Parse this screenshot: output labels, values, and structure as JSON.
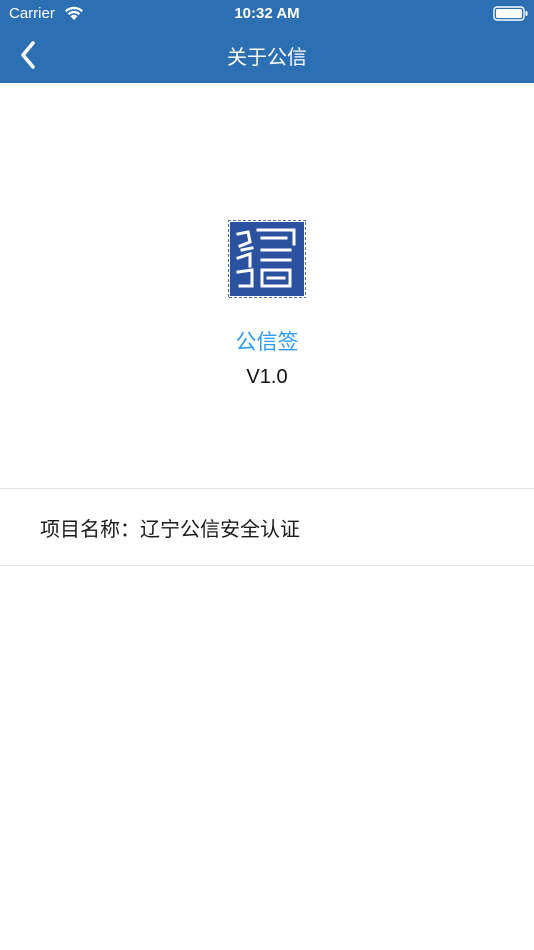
{
  "status_bar": {
    "carrier": "Carrier",
    "time": "10:32 AM"
  },
  "nav": {
    "title": "关于公信",
    "back_icon": "chevron-left-icon",
    "color": "#2c6fb2"
  },
  "app": {
    "logo_icon": "gongxin-seal-logo",
    "name": "公信签",
    "version": "V1.0",
    "name_color": "#2b9af3"
  },
  "project": {
    "label": "项目名称：",
    "value": "辽宁公信安全认证"
  }
}
